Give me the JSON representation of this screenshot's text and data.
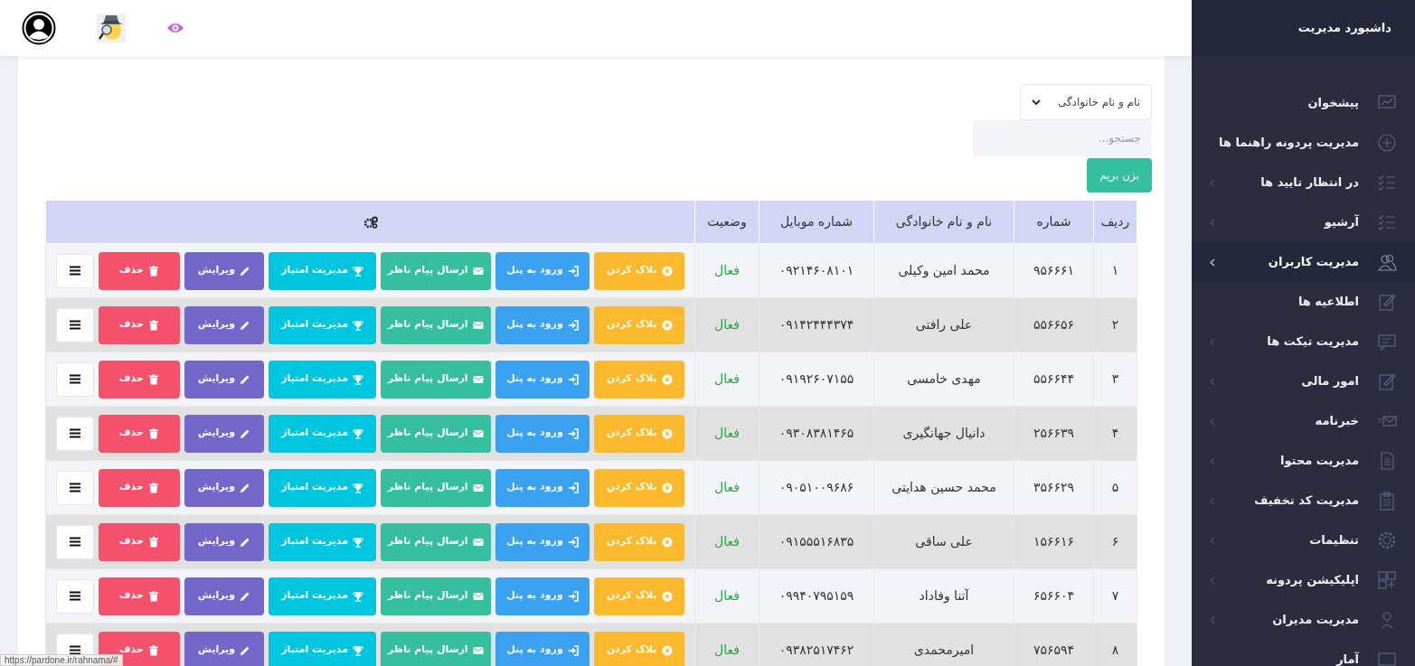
{
  "sidebar": {
    "title": "داشبورد مدیریت",
    "items": [
      {
        "label": "پیشخوان",
        "has_submenu": false,
        "selected": false
      },
      {
        "label": "مدیریت پردونه راهنما ها",
        "has_submenu": false,
        "selected": false
      },
      {
        "label": "در انتظار تایید ها",
        "has_submenu": true,
        "selected": false
      },
      {
        "label": "آرشیو",
        "has_submenu": true,
        "selected": false
      },
      {
        "label": "مدیریت کاربران",
        "has_submenu": true,
        "selected": true
      },
      {
        "label": "اطلاعیه ها",
        "has_submenu": false,
        "selected": false
      },
      {
        "label": "مدیریت تیکت ها",
        "has_submenu": true,
        "selected": false
      },
      {
        "label": "امور مالی",
        "has_submenu": true,
        "selected": false
      },
      {
        "label": "خبرنامه",
        "has_submenu": true,
        "selected": false
      },
      {
        "label": "مدیریت محتوا",
        "has_submenu": true,
        "selected": false
      },
      {
        "label": "مدیریت کد تخفیف",
        "has_submenu": true,
        "selected": false
      },
      {
        "label": "تنظیمات",
        "has_submenu": true,
        "selected": false
      },
      {
        "label": "اپلیکیشن پردونه",
        "has_submenu": true,
        "selected": false
      },
      {
        "label": "مدیریت مدیران",
        "has_submenu": true,
        "selected": false
      },
      {
        "label": "آمار",
        "has_submenu": false,
        "selected": false
      }
    ]
  },
  "search": {
    "filter": "نام و نام خانوادگی",
    "placeholder": "جستجو...",
    "button": "بزن بریم"
  },
  "table": {
    "columns": [
      "ردیف",
      "شماره",
      "نام و نام خانوادگی",
      "شماره موبایل",
      "وضعیت"
    ],
    "rows": [
      {
        "index": "۱",
        "number": "۹۵۶۶۶۱",
        "name": "محمد امین وکیلی",
        "mobile": "۰۹۲۱۴۶۰۸۱۰۱",
        "status": "فعال",
        "actions": [
          {
            "kind": "block",
            "label": "بلاک کردن"
          },
          {
            "kind": "login",
            "label": "ورود به پنل"
          },
          {
            "kind": "message",
            "label": "ارسال پیام ناظر"
          },
          {
            "kind": "score",
            "label": "مدیریت امتیاز"
          },
          {
            "kind": "edit",
            "label": "ویرایش"
          },
          {
            "kind": "delete",
            "label": "حذف"
          },
          {
            "kind": "menu"
          }
        ]
      },
      {
        "index": "۲",
        "number": "۵۵۶۶۵۶",
        "name": "علی رافتی",
        "mobile": "۰۹۱۴۲۴۴۴۳۷۴",
        "status": "فعال",
        "actions": [
          {
            "kind": "block",
            "label": "بلاک کردن"
          },
          {
            "kind": "login",
            "label": "ورود به پنل"
          },
          {
            "kind": "message",
            "label": "ارسال پیام ناظر"
          },
          {
            "kind": "score",
            "label": "مدیریت امتیاز"
          },
          {
            "kind": "edit",
            "label": "ویرایش"
          },
          {
            "kind": "delete",
            "label": "حذف"
          },
          {
            "kind": "menu"
          }
        ]
      },
      {
        "index": "۳",
        "number": "۵۵۶۶۴۴",
        "name": "مهدی خامسی",
        "mobile": "۰۹۱۹۲۶۰۷۱۵۵",
        "status": "فعال",
        "actions": [
          {
            "kind": "block",
            "label": "بلاک کردن"
          },
          {
            "kind": "login",
            "label": "ورود به پنل"
          },
          {
            "kind": "message",
            "label": "ارسال پیام ناظر"
          },
          {
            "kind": "score",
            "label": "مدیریت امتیاز"
          },
          {
            "kind": "edit",
            "label": "ویرایش"
          },
          {
            "kind": "delete",
            "label": "حذف"
          },
          {
            "kind": "menu"
          }
        ]
      },
      {
        "index": "۴",
        "number": "۲۵۶۶۳۹",
        "name": "دانیال جهانگیری",
        "mobile": "۰۹۳۰۸۳۸۱۴۶۵",
        "status": "فعال",
        "actions": [
          {
            "kind": "block",
            "label": "بلاک کردن"
          },
          {
            "kind": "login",
            "label": "ورود به پنل"
          },
          {
            "kind": "message",
            "label": "ارسال پیام ناظر"
          },
          {
            "kind": "score",
            "label": "مدیریت امتیاز"
          },
          {
            "kind": "edit",
            "label": "ویرایش"
          },
          {
            "kind": "delete",
            "label": "حذف"
          },
          {
            "kind": "menu"
          }
        ]
      },
      {
        "index": "۵",
        "number": "۳۵۶۶۲۹",
        "name": "محمد حسین هدایتی",
        "mobile": "۰۹۰۵۱۰۰۹۶۸۶",
        "status": "فعال",
        "actions": [
          {
            "kind": "block",
            "label": "بلاک کردن"
          },
          {
            "kind": "login",
            "label": "ورود به پنل"
          },
          {
            "kind": "message",
            "label": "ارسال پیام ناظر"
          },
          {
            "kind": "score",
            "label": "مدیریت امتیاز"
          },
          {
            "kind": "edit",
            "label": "ویرایش"
          },
          {
            "kind": "delete",
            "label": "حذف"
          },
          {
            "kind": "menu"
          }
        ]
      },
      {
        "index": "۶",
        "number": "۱۵۶۶۱۶",
        "name": "علی ساقی",
        "mobile": "۰۹۱۵۵۵۱۶۸۳۵",
        "status": "فعال",
        "actions": [
          {
            "kind": "block",
            "label": "بلاک کردن"
          },
          {
            "kind": "login",
            "label": "ورود به پنل"
          },
          {
            "kind": "message",
            "label": "ارسال پیام ناظر"
          },
          {
            "kind": "score",
            "label": "مدیریت امتیاز"
          },
          {
            "kind": "edit",
            "label": "ویرایش"
          },
          {
            "kind": "delete",
            "label": "حذف"
          },
          {
            "kind": "menu"
          }
        ]
      },
      {
        "index": "۷",
        "number": "۶۵۶۶۰۴",
        "name": "آتنا وفاداد",
        "mobile": "۰۹۹۴۰۷۹۵۱۵۹",
        "status": "فعال",
        "actions": [
          {
            "kind": "block",
            "label": "بلاک کردن"
          },
          {
            "kind": "login",
            "label": "ورود به پنل"
          },
          {
            "kind": "message",
            "label": "ارسال پیام ناظر"
          },
          {
            "kind": "score",
            "label": "مدیریت امتیاز"
          },
          {
            "kind": "edit",
            "label": "ویرایش"
          },
          {
            "kind": "delete",
            "label": "حذف"
          },
          {
            "kind": "menu"
          }
        ]
      },
      {
        "index": "۸",
        "number": "۷۵۶۵۹۴",
        "name": "امیرمحمدی",
        "mobile": "۰۹۳۸۲۵۱۷۴۶۲",
        "status": "فعال",
        "actions": [
          {
            "kind": "block",
            "label": "بلاک کردن"
          },
          {
            "kind": "login",
            "label": "ورود به پنل"
          },
          {
            "kind": "message",
            "label": "ارسال پیام ناظر"
          },
          {
            "kind": "score",
            "label": "مدیریت امتیاز"
          },
          {
            "kind": "edit",
            "label": "ویرایش"
          },
          {
            "kind": "delete",
            "label": "حذف"
          },
          {
            "kind": "menu"
          }
        ]
      }
    ]
  },
  "status_bar": {
    "url": "https://pardone.ir/rahnama/#"
  }
}
